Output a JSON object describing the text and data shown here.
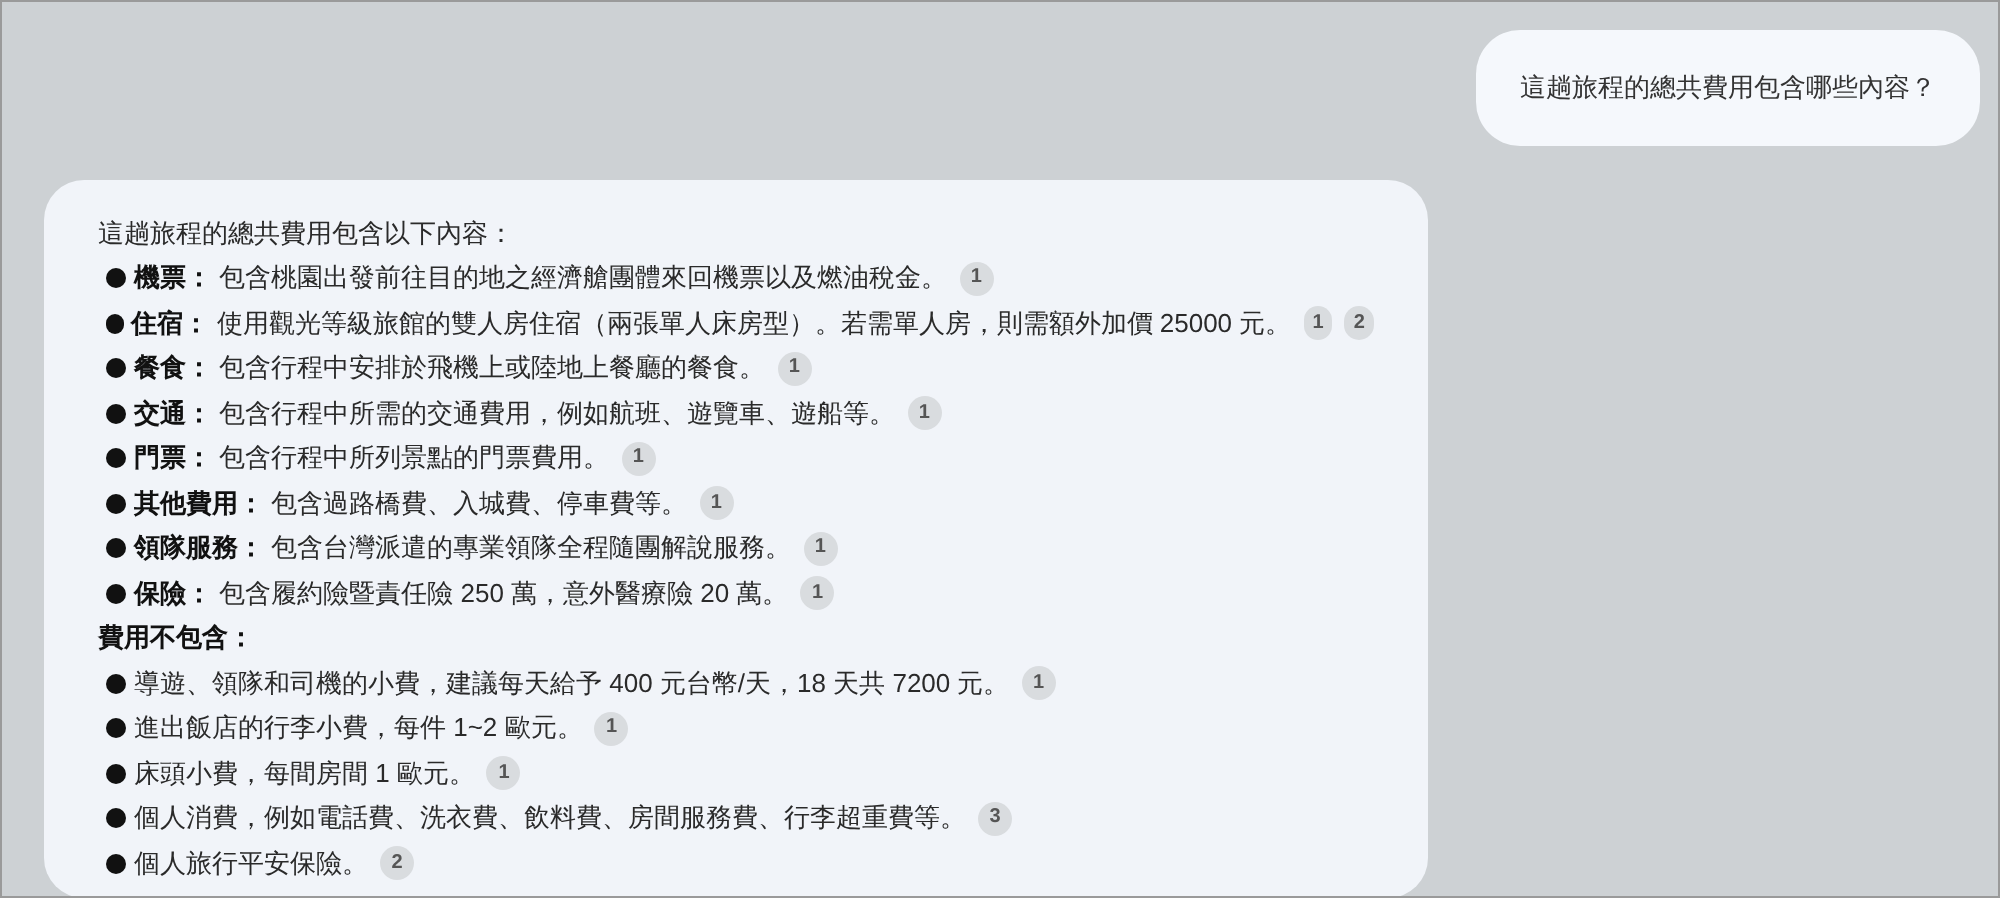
{
  "user_message": "這趟旅程的總共費用包含哪些內容？",
  "assistant": {
    "intro": "這趟旅程的總共費用包含以下內容：",
    "included": [
      {
        "label": "機票：",
        "text": "包含桃園出發前往目的地之經濟艙團體來回機票以及燃油稅金。",
        "citations": [
          "1"
        ]
      },
      {
        "label": "住宿：",
        "text": "使用觀光等級旅館的雙人房住宿（兩張單人床房型）。若需單人房，則需額外加價 25000 元。",
        "citations": [
          "1",
          "2"
        ]
      },
      {
        "label": "餐食：",
        "text": "包含行程中安排於飛機上或陸地上餐廳的餐食。",
        "citations": [
          "1"
        ]
      },
      {
        "label": "交通：",
        "text": "包含行程中所需的交通費用，例如航班、遊覽車、遊船等。",
        "citations": [
          "1"
        ]
      },
      {
        "label": "門票：",
        "text": "包含行程中所列景點的門票費用。",
        "citations": [
          "1"
        ]
      },
      {
        "label": "其他費用：",
        "text": "包含過路橋費、入城費、停車費等。",
        "citations": [
          "1"
        ]
      },
      {
        "label": "領隊服務：",
        "text": "包含台灣派遣的專業領隊全程隨團解說服務。",
        "citations": [
          "1"
        ]
      },
      {
        "label": "保險：",
        "text": "包含履約險暨責任險 250 萬，意外醫療險 20 萬。",
        "citations": [
          "1"
        ]
      }
    ],
    "excluded_heading": "費用不包含：",
    "excluded": [
      {
        "text": "導遊、領隊和司機的小費，建議每天給予 400 元台幣/天，18 天共 7200 元。",
        "citations": [
          "1"
        ]
      },
      {
        "text": "進出飯店的行李小費，每件 1~2 歐元。",
        "citations": [
          "1"
        ]
      },
      {
        "text": "床頭小費，每間房間 1 歐元。",
        "citations": [
          "1"
        ]
      },
      {
        "text": "個人消費，例如電話費、洗衣費、飲料費、房間服務費、行李超重費等。",
        "citations": [
          "3"
        ]
      },
      {
        "text": "個人旅行平安保險。",
        "citations": [
          "2"
        ]
      }
    ]
  }
}
